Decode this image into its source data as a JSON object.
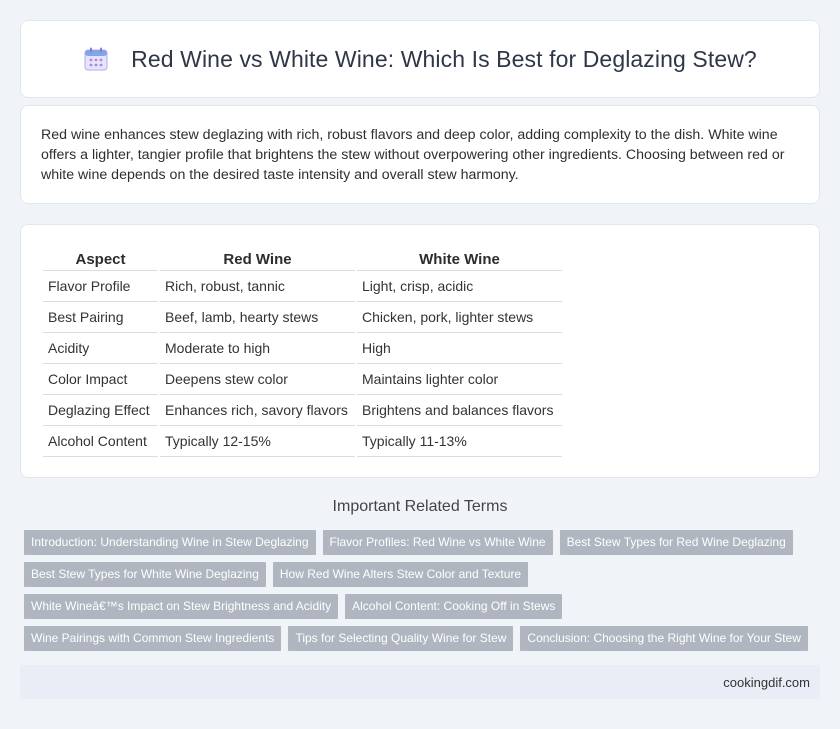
{
  "header": {
    "title": "Red Wine vs White Wine: Which Is Best for Deglazing Stew?",
    "icon": "calendar-icon"
  },
  "intro": {
    "text": "Red wine enhances stew deglazing with rich, robust flavors and deep color, adding complexity to the dish. White wine offers a lighter, tangier profile that brightens the stew without overpowering other ingredients. Choosing between red or white wine depends on the desired taste intensity and overall stew harmony."
  },
  "table": {
    "headers": [
      "Aspect",
      "Red Wine",
      "White Wine"
    ],
    "rows": [
      [
        "Flavor Profile",
        "Rich, robust, tannic",
        "Light, crisp, acidic"
      ],
      [
        "Best Pairing",
        "Beef, lamb, hearty stews",
        "Chicken, pork, lighter stews"
      ],
      [
        "Acidity",
        "Moderate to high",
        "High"
      ],
      [
        "Color Impact",
        "Deepens stew color",
        "Maintains lighter color"
      ],
      [
        "Deglazing Effect",
        "Enhances rich, savory flavors",
        "Brightens and balances flavors"
      ],
      [
        "Alcohol Content",
        "Typically 12-15%",
        "Typically 11-13%"
      ]
    ]
  },
  "related": {
    "title": "Important Related Terms",
    "tags": [
      "Introduction: Understanding Wine in Stew Deglazing",
      "Flavor Profiles: Red Wine vs White Wine",
      "Best Stew Types for Red Wine Deglazing",
      "Best Stew Types for White Wine Deglazing",
      "How Red Wine Alters Stew Color and Texture",
      "White Wineâ€™s Impact on Stew Brightness and Acidity",
      "Alcohol Content: Cooking Off in Stews",
      "Wine Pairings with Common Stew Ingredients",
      "Tips for Selecting Quality Wine for Stew",
      "Conclusion: Choosing the Right Wine for Your Stew"
    ]
  },
  "footer": {
    "site": "cookingdif.com"
  },
  "colors": {
    "background": "#f0f4f8",
    "tag": "#b0b6c0",
    "footer": "#e8edf6"
  }
}
